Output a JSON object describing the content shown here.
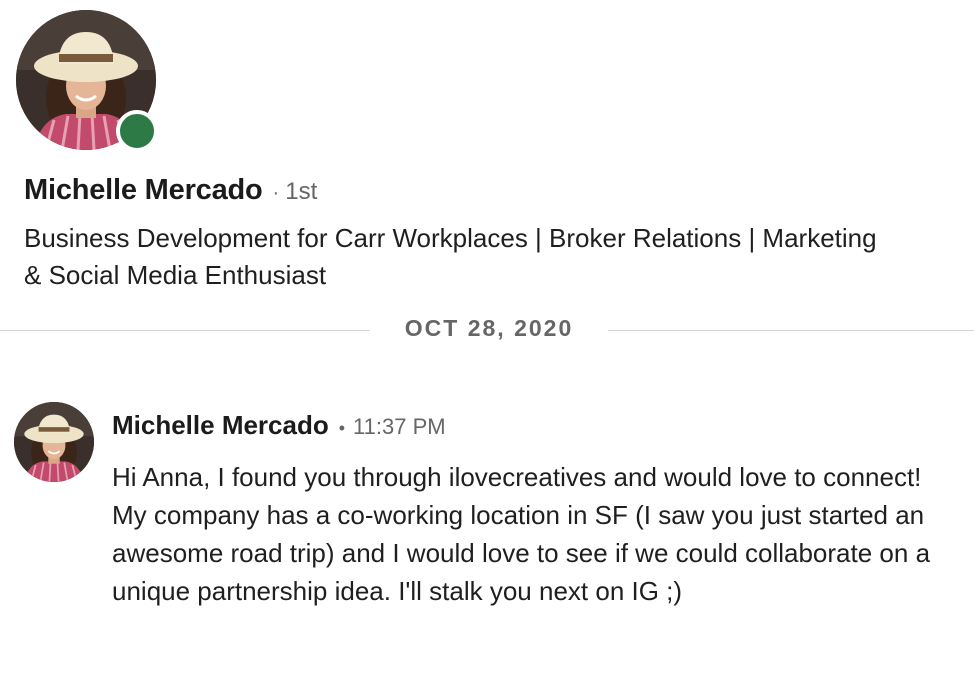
{
  "profile": {
    "name": "Michelle Mercado",
    "separator": "·",
    "degree": "1st",
    "headline": "Business Development for Carr Workplaces | Broker Relations | Marketing & Social Media Enthusiast",
    "presence": "online",
    "presence_color": "#2d7a46",
    "avatar_icon": "profile-photo"
  },
  "conversation": {
    "date_divider": "OCT 28, 2020",
    "messages": [
      {
        "sender": "Michelle Mercado",
        "separator": "•",
        "time": "11:37 PM",
        "text": "Hi Anna, I found you through ilovecreatives and would love to connect! My company has a co-working location in SF (I saw you just started an awesome road trip) and I would love to see if we could collaborate on a unique partnership idea. I'll stalk you next on IG ;)",
        "avatar_icon": "profile-photo"
      }
    ]
  }
}
